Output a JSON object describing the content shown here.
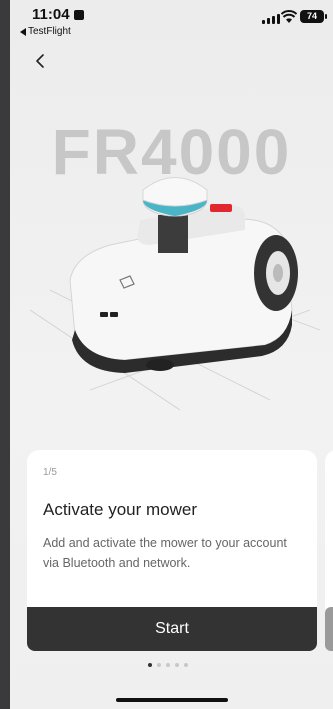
{
  "status_bar": {
    "time": "11:04",
    "back_app": "TestFlight",
    "battery": "74"
  },
  "hero": {
    "model_name": "FR4000"
  },
  "onboarding_card": {
    "step": "1/5",
    "title": "Activate your mower",
    "description": "Add and activate the mower to your account via Bluetooth and network.",
    "button_label": "Start"
  },
  "pagination": {
    "total": 5,
    "active_index": 0
  }
}
